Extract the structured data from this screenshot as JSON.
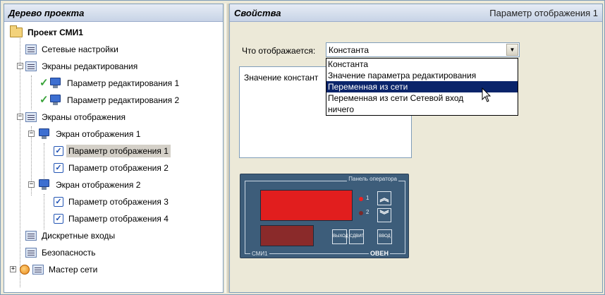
{
  "left_panel": {
    "title": "Дерево проекта",
    "tree": [
      {
        "label": "Проект СМИ1",
        "icon": "folder-icon"
      },
      {
        "label": "Сетевые настройки",
        "icon": "settings-doc-icon"
      },
      {
        "label": "Экраны редактирования",
        "icon": "screens-doc-icon"
      },
      {
        "label": "Параметр редактирования 1",
        "icon": "monitor-icon"
      },
      {
        "label": "Параметр редактирования 2",
        "icon": "monitor-icon"
      },
      {
        "label": "Экраны отображения",
        "icon": "screens-doc-icon"
      },
      {
        "label": "Экран отображения 1",
        "icon": "monitor-icon"
      },
      {
        "label": "Параметр отображения 1",
        "icon": "checkbox-icon"
      },
      {
        "label": "Параметр отображения 2",
        "icon": "checkbox-icon"
      },
      {
        "label": "Экран отображения 2",
        "icon": "monitor-icon"
      },
      {
        "label": "Параметр отображения 3",
        "icon": "checkbox-icon"
      },
      {
        "label": "Параметр отображения 4",
        "icon": "checkbox-icon"
      },
      {
        "label": "Дискретные входы",
        "icon": "doc-icon"
      },
      {
        "label": "Безопасность",
        "icon": "doc-icon"
      },
      {
        "label": "Мастер сети",
        "icon": "doc-icon"
      }
    ]
  },
  "right_panel": {
    "title": "Свойства",
    "subtitle": "Параметр отображения 1",
    "field_label": "Что отображается:",
    "combo_value": "Константа",
    "dropdown_options": [
      "Константа",
      "Значение параметра редактирования",
      "Переменная из сети",
      "Переменная из сети Сетевой вход",
      "ничего"
    ],
    "highlighted_option": "Переменная из сети",
    "panel_text": "Значение констант",
    "device": {
      "panel_title": "Панель оператора",
      "model": "СМИ1",
      "brand": "ОВЕН",
      "indicator_1": "1",
      "indicator_2": "2",
      "key_exit": "ВЫХОД",
      "key_shift": "СДВИГ",
      "key_enter": "ВВОД"
    }
  },
  "colors": {
    "selection": "#0a246a",
    "display_red": "#e11e1e",
    "device_body": "#3d5d7a"
  }
}
